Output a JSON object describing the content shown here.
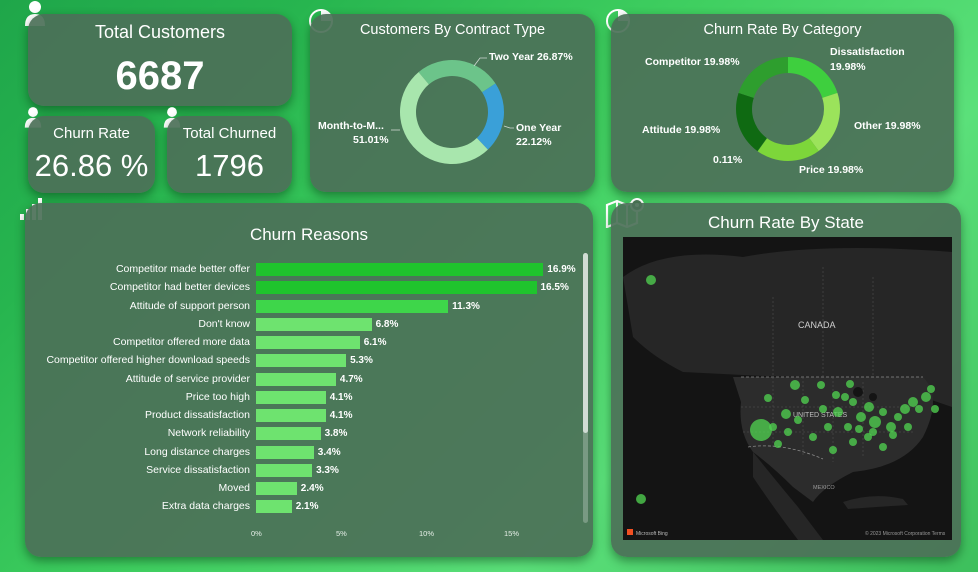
{
  "kpis": {
    "total_customers": {
      "title": "Total Customers",
      "value": "6687"
    },
    "churn_rate": {
      "title": "Churn Rate",
      "value": "26.86 %"
    },
    "total_churned": {
      "title": "Total Churned",
      "value": "1796"
    }
  },
  "contract": {
    "title": "Customers By Contract Type",
    "labels": {
      "two_year": "Two Year 26.87%",
      "one_year_name": "One Year",
      "one_year_pct": "22.12%",
      "month_name": "Month-to-M...",
      "month_pct": "51.01%"
    }
  },
  "category": {
    "title": "Churn Rate By Category",
    "labels": {
      "competitor": "Competitor 19.98%",
      "dissatisfaction_name": "Dissatisfaction",
      "dissatisfaction_pct": "19.98%",
      "other": "Other 19.98%",
      "attitude": "Attitude 19.98%",
      "small": "0.11%",
      "price": "Price 19.98%"
    }
  },
  "reasons": {
    "title": "Churn Reasons",
    "ticks": [
      "0%",
      "5%",
      "10%",
      "15%"
    ]
  },
  "map": {
    "title": "Churn Rate By State",
    "country_label": "CANADA",
    "us_label": "UNITED STATES",
    "mexico_label": "MEXICO",
    "attribution": "Microsoft Bing",
    "copyright": "© 2023 Microsoft Corporation Terms"
  },
  "colors": {
    "donut_contract": [
      "#a8e6ad",
      "#6cc48a",
      "#3aa0d8"
    ],
    "donut_category": [
      "#3ecf3e",
      "#9be35b",
      "#7dd63a",
      "#1d7a1d",
      "#0f6a12",
      "#2e9e2e"
    ],
    "bar_top": "#1fc42d",
    "bar_light": "#6ee36f"
  },
  "chart_data": [
    {
      "type": "pie",
      "title": "Customers By Contract Type",
      "categories": [
        "Month-to-Month",
        "Two Year",
        "One Year"
      ],
      "values": [
        51.01,
        26.87,
        22.12
      ]
    },
    {
      "type": "pie",
      "title": "Churn Rate By Category",
      "categories": [
        "Dissatisfaction",
        "Other",
        "Price",
        "(blank)",
        "Attitude",
        "Competitor"
      ],
      "values": [
        19.98,
        19.98,
        19.98,
        0.11,
        19.98,
        19.98
      ]
    },
    {
      "type": "bar",
      "orientation": "horizontal",
      "title": "Churn Reasons",
      "categories": [
        "Competitor made better offer",
        "Competitor had better devices",
        "Attitude of support person",
        "Don't know",
        "Competitor offered more data",
        "Competitor offered higher download speeds",
        "Attitude of service provider",
        "Price too high",
        "Product dissatisfaction",
        "Network reliability",
        "Long distance charges",
        "Service dissatisfaction",
        "Moved",
        "Extra data charges"
      ],
      "values": [
        16.9,
        16.5,
        11.3,
        6.8,
        6.1,
        5.3,
        4.7,
        4.1,
        4.1,
        3.8,
        3.4,
        3.3,
        2.4,
        2.1
      ],
      "value_labels": [
        "16.9%",
        "16.5%",
        "11.3%",
        "6.8%",
        "6.1%",
        "5.3%",
        "4.7%",
        "4.1%",
        "4.1%",
        "3.8%",
        "3.4%",
        "3.3%",
        "2.4%",
        "2.1%"
      ],
      "xlim": [
        0,
        17.5
      ]
    }
  ]
}
